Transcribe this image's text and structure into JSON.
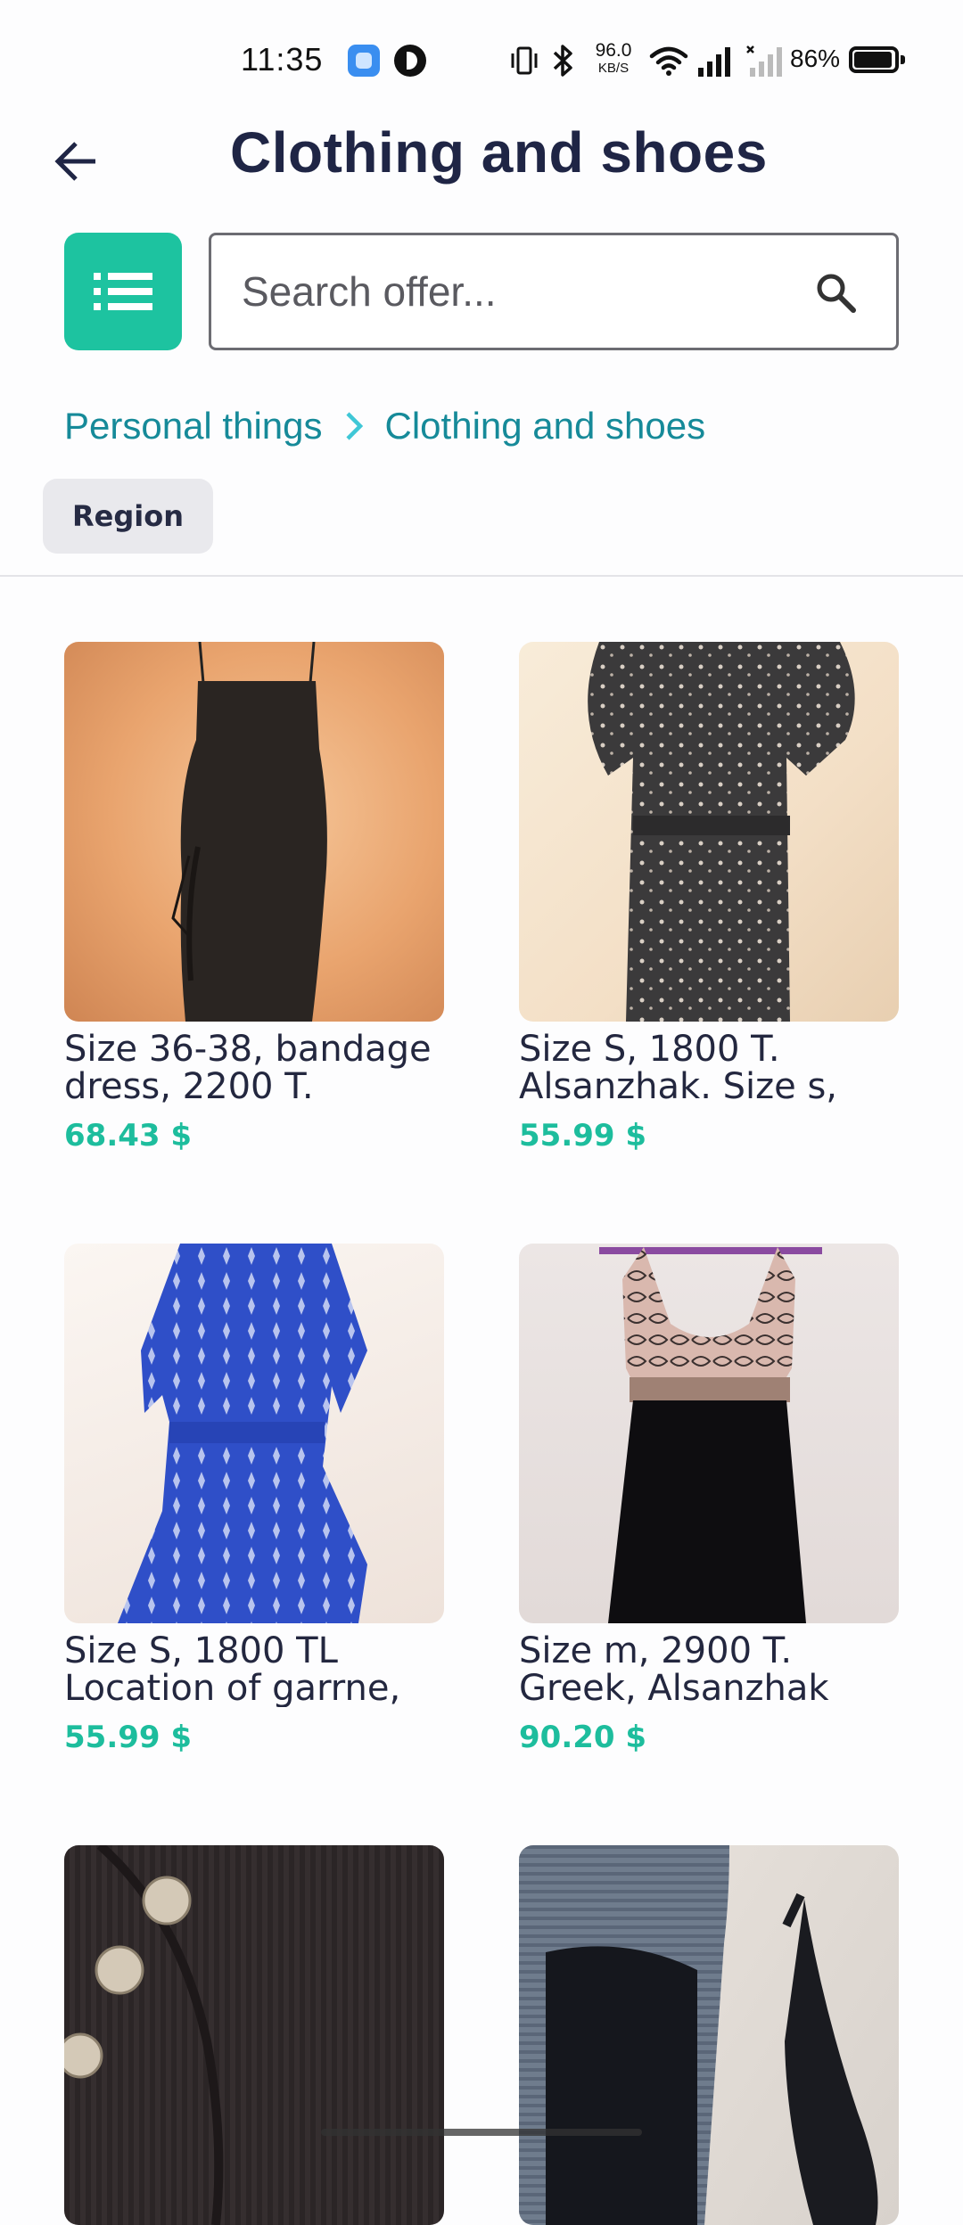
{
  "status_bar": {
    "time": "11:35",
    "net_speed_value": "96.0",
    "net_speed_unit": "KB/S",
    "battery_percent": "86%"
  },
  "header": {
    "title": "Clothing and shoes",
    "back_icon": "arrow-left-icon"
  },
  "toolbar": {
    "menu_icon": "list-icon",
    "search_placeholder": "Search offer...",
    "search_value": "",
    "search_icon": "search-icon"
  },
  "breadcrumb": {
    "items": [
      "Personal things",
      "Clothing and shoes"
    ],
    "separator_icon": "chevron-right-icon"
  },
  "filters": {
    "region_label": "Region"
  },
  "listings": [
    {
      "title": "Size 36-38, bandage\ndress, 2200 T.",
      "price": "68.43 $",
      "image": "black bandage dress on hanger"
    },
    {
      "title": "Size S, 1800 T.\n Alsanzhak. Size s,",
      "price": "55.99 $",
      "image": "black dotted dress on hanger"
    },
    {
      "title": "Size S, 1800 TL\n Location of garrne,",
      "price": "55.99 $",
      "image": "blue patterned dress on hanger"
    },
    {
      "title": "Size m, 2900 T.\n Greek, Alsanzhak",
      "price": "90.20 $",
      "image": "black dress with lace top"
    },
    {
      "title": "",
      "price": "",
      "image": "black knit sweater with buttons"
    },
    {
      "title": "",
      "price": "",
      "image": "black high-heel shoes"
    }
  ],
  "colors": {
    "accent": "#1dc3a0",
    "price": "#1dbd9d",
    "breadcrumb": "#168a99",
    "title": "#1f2545"
  }
}
